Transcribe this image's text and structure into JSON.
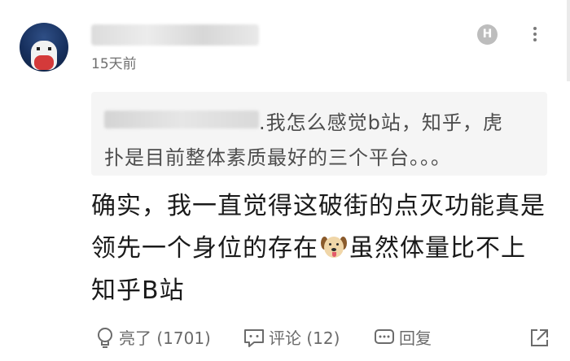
{
  "comment": {
    "timestamp": "15天前",
    "badge": "H",
    "quote": {
      "line1": ".我怎么感觉b站，知乎，虎",
      "line2": "扑是目前整体素质最好的三个平台。。。"
    },
    "body": {
      "line1": "确实，我一直觉得这破街的点灭功能真是",
      "line2_before_emoji": "领先一个身位的存在",
      "emoji": "dog-face",
      "line2_after_emoji": "虽然体量比不上",
      "line3": "知乎B站"
    },
    "actions": {
      "like_label": "亮了 (1701)",
      "comment_label": "评论 (12)",
      "reply_label": "回复"
    }
  },
  "colors": {
    "text_primary": "#1a1a1a",
    "text_secondary": "#6b6b6b",
    "quote_bg": "#f5f5f5",
    "badge_bg": "#bdbdbd"
  }
}
